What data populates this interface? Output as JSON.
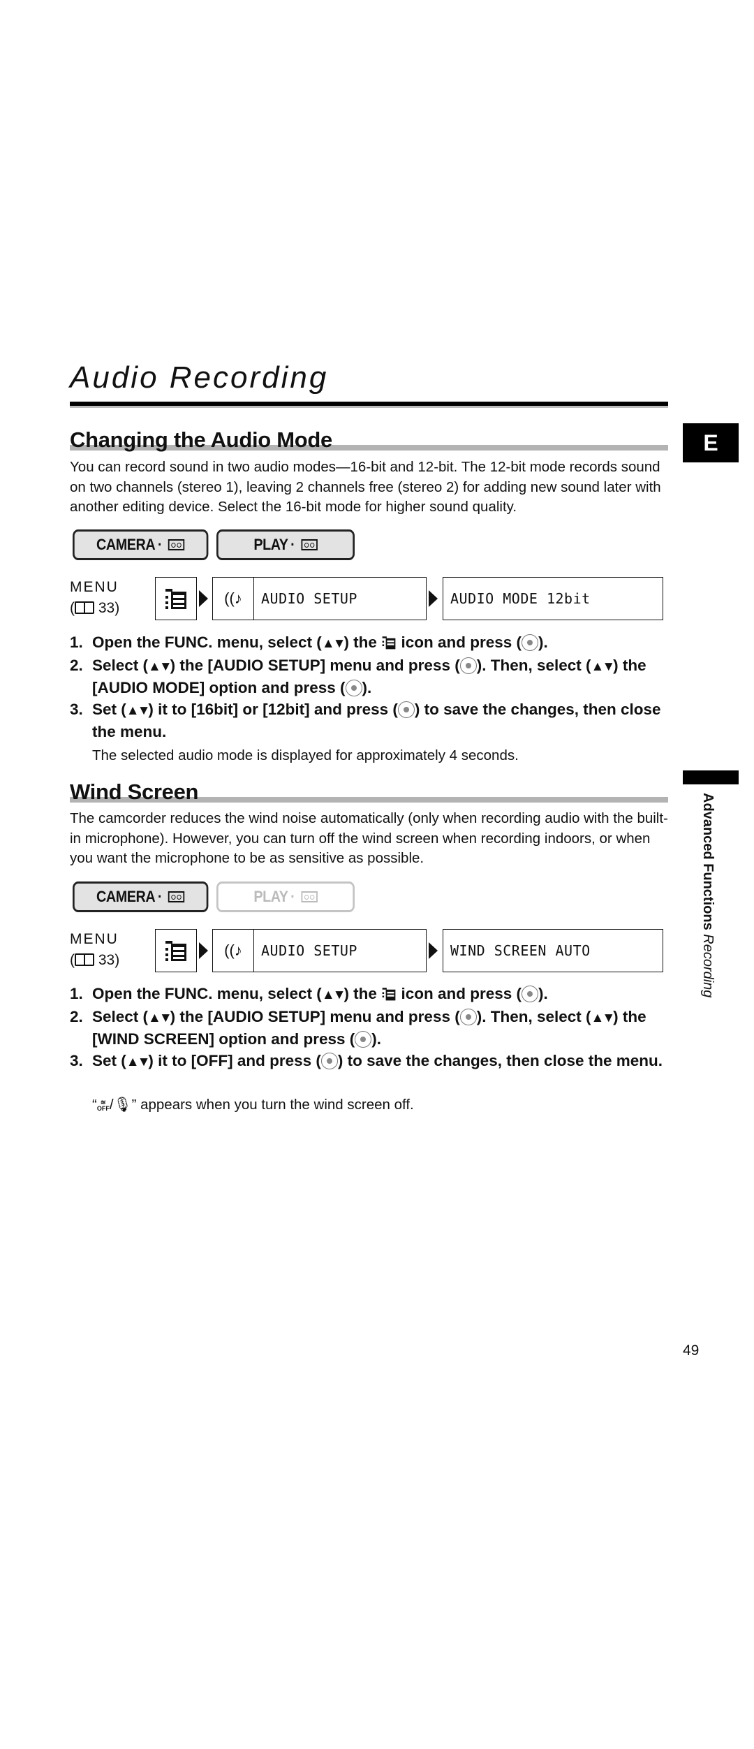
{
  "page": {
    "title": "Audio Recording",
    "language_tab": "E",
    "side_tab": {
      "chapter": "Advanced Functions",
      "section": "Recording"
    },
    "page_number": "49"
  },
  "sections": [
    {
      "heading": "Changing the Audio Mode",
      "body": "You can record sound in two audio modes—16-bit and 12-bit. The 12-bit mode records sound on two channels (stereo 1), leaving 2 channels free (stereo 2) for adding new sound later with another editing device. Select the 16-bit mode for higher sound quality.",
      "modes": [
        {
          "label": "CAMERA",
          "icon": "tape-icon",
          "enabled": true
        },
        {
          "label": "PLAY",
          "icon": "tape-icon",
          "enabled": true
        }
      ],
      "menu": {
        "label": "MENU",
        "ref": "33",
        "submenu_icon": "audio-setup-icon",
        "submenu": "AUDIO SETUP",
        "setting": "AUDIO MODE 12bit"
      },
      "steps": [
        {
          "num": "1.",
          "parts": [
            "Open the FUNC. menu, select (",
            ") the ",
            " icon and press (",
            ")."
          ]
        },
        {
          "num": "2.",
          "parts": [
            "Select (",
            ") the [AUDIO SETUP] menu and press (",
            "). Then, select (",
            ") the [AUDIO MODE] option and press (",
            ")."
          ]
        },
        {
          "num": "3.",
          "parts": [
            "Set (",
            ") it to [16bit] or [12bit] and press (",
            ") to save the changes, then close the menu."
          ]
        }
      ],
      "note": "The selected audio mode is displayed for approximately 4 seconds."
    },
    {
      "heading": "Wind Screen",
      "body": "The camcorder reduces the wind noise automatically (only when recording audio with the built-in microphone). However, you can turn off the wind screen when recording indoors, or when you want the microphone to be as sensitive as possible.",
      "modes": [
        {
          "label": "CAMERA",
          "icon": "tape-icon",
          "enabled": true
        },
        {
          "label": "PLAY",
          "icon": "tape-icon",
          "enabled": false
        }
      ],
      "menu": {
        "label": "MENU",
        "ref": "33",
        "submenu_icon": "audio-setup-icon",
        "submenu": "AUDIO SETUP",
        "setting": "WIND SCREEN AUTO"
      },
      "steps": [
        {
          "num": "1.",
          "parts": [
            "Open the FUNC. menu, select (",
            ") the ",
            " icon and press (",
            ")."
          ]
        },
        {
          "num": "2.",
          "parts": [
            "Select (",
            ") the [AUDIO SETUP] menu and press (",
            "). Then, select (",
            ") the [WIND SCREEN] option and press (",
            ")."
          ]
        },
        {
          "num": "3.",
          "parts": [
            "Set (",
            ") it to [OFF] and press (",
            ") to save the changes, then close the menu."
          ]
        }
      ],
      "note": {
        "open_quote": "“",
        "icon_text": "OFF",
        "close_text": "” appears when you turn the wind screen off."
      }
    }
  ]
}
